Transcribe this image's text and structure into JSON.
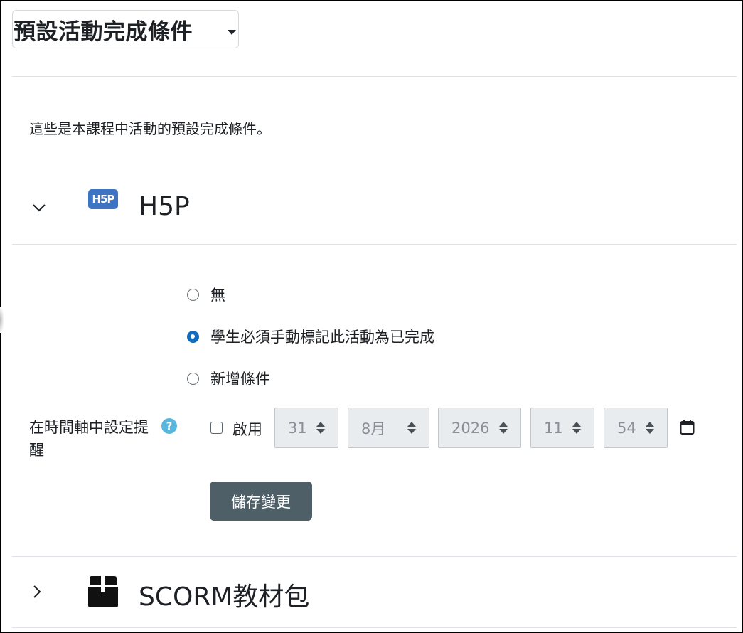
{
  "header": {
    "title": "預設活動完成條件"
  },
  "intro_text": "這些是本課程中活動的預設完成條件。",
  "sections": [
    {
      "title": "H5P",
      "icon": "h5p-logo",
      "logo_text": "H5P",
      "expanded": true
    },
    {
      "title": "SCORM教材包",
      "icon": "package-box-icon",
      "expanded": false
    }
  ],
  "completion_options": [
    {
      "label": "無",
      "selected": false
    },
    {
      "label": "學生必須手動標記此活動為已完成",
      "selected": true
    },
    {
      "label": "新增條件",
      "selected": false
    }
  ],
  "timeline": {
    "label": "在時間軸中設定提醒",
    "enable_label": "啟用",
    "enabled": false,
    "day": "31",
    "month": "8月",
    "year": "2026",
    "hour": "11",
    "minute": "54"
  },
  "save_button": "儲存變更",
  "colors": {
    "primary": "#0f6cbf",
    "save_button_bg": "#4f5f67",
    "help_icon": "#5ab6dc",
    "h5p_logo": "#3d74c4"
  }
}
